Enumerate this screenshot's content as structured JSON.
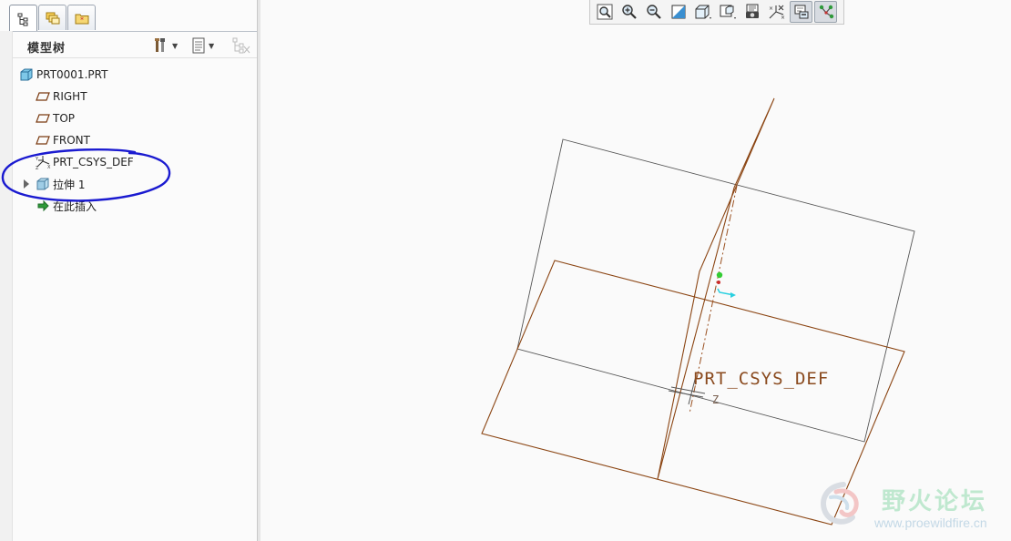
{
  "tree_panel": {
    "title": "模型树",
    "tabs": [
      {
        "name": "model-tree",
        "icon": "tree-icon"
      },
      {
        "name": "layers",
        "icon": "layers-icon"
      },
      {
        "name": "favorites",
        "icon": "folder-star-icon"
      }
    ],
    "header_buttons": [
      "settings-icon",
      "show-icon",
      "filter-icon"
    ]
  },
  "tree": {
    "root": {
      "label": "PRT0001.PRT",
      "icon": "part-icon"
    },
    "items": [
      {
        "label": "RIGHT",
        "icon": "datum-plane-icon"
      },
      {
        "label": "TOP",
        "icon": "datum-plane-icon"
      },
      {
        "label": "FRONT",
        "icon": "datum-plane-icon"
      },
      {
        "label": "PRT_CSYS_DEF",
        "icon": "csys-icon"
      },
      {
        "label": "拉伸 1",
        "icon": "extrude-icon",
        "expandable": true
      },
      {
        "label": "在此插入",
        "icon": "insert-here-icon"
      }
    ],
    "annotation_color": "#1a1ad0"
  },
  "toolbar": {
    "buttons": [
      "refit-icon",
      "zoom-in-icon",
      "zoom-out-icon",
      "repaint-icon",
      "view-orient-icon",
      "saved-views-icon",
      "view-manager-icon",
      "display-style-icon",
      "datum-display-icon",
      "spin-center-icon"
    ]
  },
  "viewport": {
    "csys_label": "PRT_CSYS_DEF",
    "z_axis_label": "Z",
    "line_colors": {
      "gray": "#555555",
      "brown": "#8b4513"
    }
  },
  "watermark": {
    "title": "野火论坛",
    "url": "www.proewildfire.cn"
  }
}
